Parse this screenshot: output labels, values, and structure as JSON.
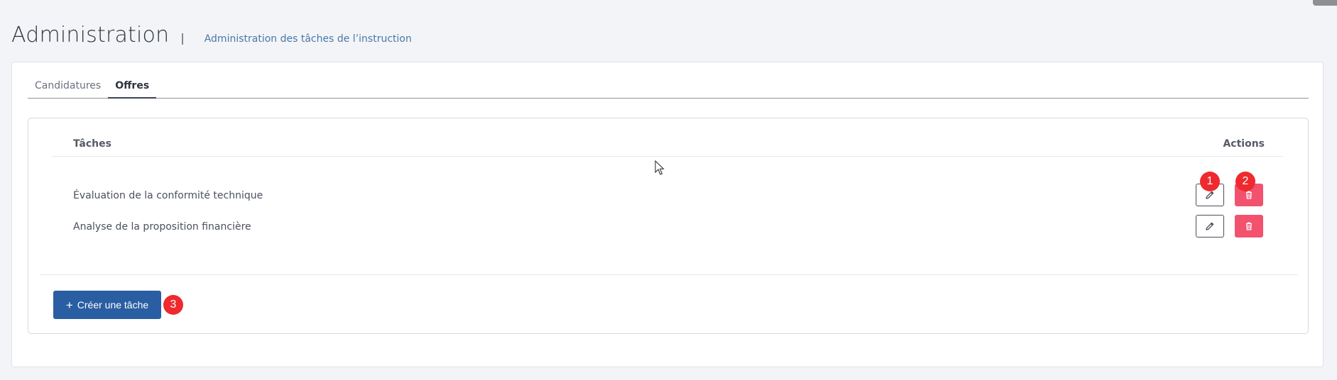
{
  "header": {
    "title": "Administration",
    "separator": "|",
    "subtitle": "Administration des tâches de l’instruction"
  },
  "tabs": [
    {
      "label": "Candidatures",
      "active": false
    },
    {
      "label": "Offres",
      "active": true
    }
  ],
  "table": {
    "columns": {
      "tasks": "Tâches",
      "actions": "Actions"
    },
    "rows": [
      {
        "label": "Évaluation de la conformité technique",
        "actions": [
          "edit-icon",
          "trash-icon"
        ]
      },
      {
        "label": "Analyse de la proposition financière",
        "actions": [
          "edit-icon",
          "trash-icon"
        ]
      }
    ]
  },
  "create_button": {
    "label": "Créer une tâche",
    "icon": "plus-icon"
  },
  "annotations": [
    "1",
    "2",
    "3"
  ],
  "colors": {
    "primary": "#2a5ea3",
    "danger": "#f2526e",
    "marker": "#ee2a2f",
    "subtitle": "#4a78a8"
  }
}
